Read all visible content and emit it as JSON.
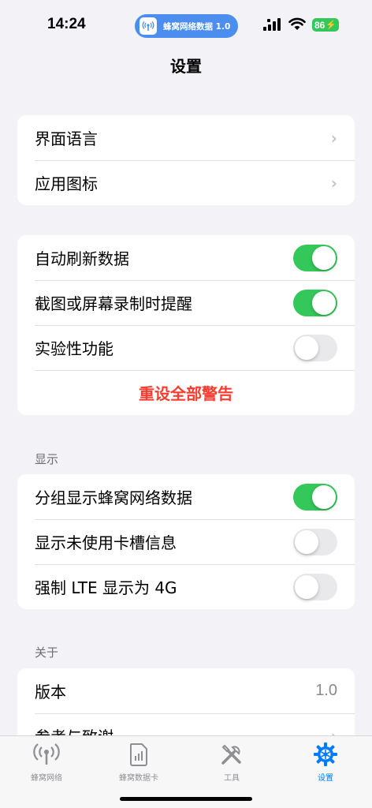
{
  "status_bar": {
    "time": "14:24",
    "app_pill": "蜂窝网络数据 1.0",
    "battery": "86"
  },
  "nav": {
    "title": "设置"
  },
  "group1": {
    "rows": [
      {
        "label": "界面语言"
      },
      {
        "label": "应用图标"
      }
    ]
  },
  "group2": {
    "rows": [
      {
        "label": "自动刷新数据",
        "on": true
      },
      {
        "label": "截图或屏幕录制时提醒",
        "on": true
      },
      {
        "label": "实验性功能",
        "on": false
      }
    ],
    "reset_label": "重设全部警告"
  },
  "display": {
    "header": "显示",
    "rows": [
      {
        "label": "分组显示蜂窝网络数据",
        "on": true
      },
      {
        "label": "显示未使用卡槽信息",
        "on": false
      },
      {
        "label": "强制 LTE 显示为 4G",
        "on": false
      }
    ]
  },
  "about": {
    "header": "关于",
    "version_label": "版本",
    "version_value": "1.0",
    "credits_label": "参考与致谢"
  },
  "tabs": [
    {
      "label": "蜂窝网络",
      "icon": "antenna-icon",
      "active": false
    },
    {
      "label": "蜂窝数据卡",
      "icon": "sim-card-icon",
      "active": false
    },
    {
      "label": "工具",
      "icon": "tools-icon",
      "active": false
    },
    {
      "label": "设置",
      "icon": "gear-icon",
      "active": true
    }
  ],
  "colors": {
    "accent": "#007aff",
    "toggle_on": "#34c759",
    "danger": "#ff3b30",
    "pill": "#4b8ef0"
  }
}
